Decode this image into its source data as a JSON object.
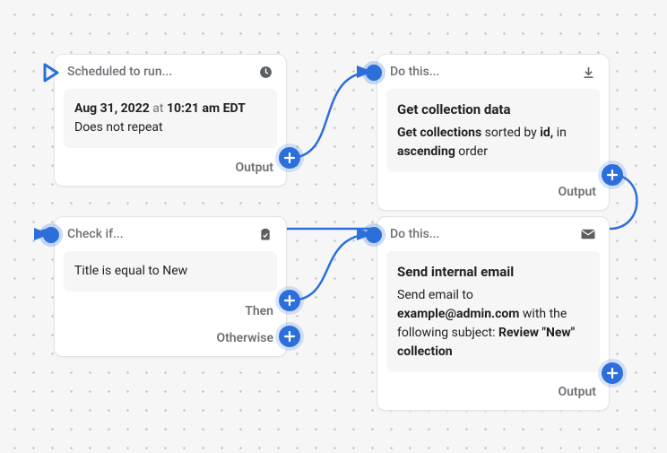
{
  "nodes": {
    "scheduled": {
      "header": "Scheduled to run...",
      "date": "Aug 31, 2022",
      "at_word": "at",
      "time": "10:21 am EDT",
      "repeat": "Does not repeat",
      "output_label": "Output"
    },
    "get_collection": {
      "header": "Do this...",
      "title": "Get collection data",
      "line_pre": "Get collections",
      "line_mid": " sorted by ",
      "line_id": "id,",
      "line_in": " in ",
      "line_order": "ascending",
      "line_post": " order",
      "output_label": "Output"
    },
    "check": {
      "header": "Check if...",
      "condition": "Title is equal to New",
      "then_label": "Then",
      "otherwise_label": "Otherwise"
    },
    "send_email": {
      "header": "Do this...",
      "title": "Send internal email",
      "line1": "Send email to ",
      "email": "example@admin.com",
      "line2": " with the following subject: ",
      "subject": "Review \"New\" collection",
      "output_label": "Output"
    }
  }
}
